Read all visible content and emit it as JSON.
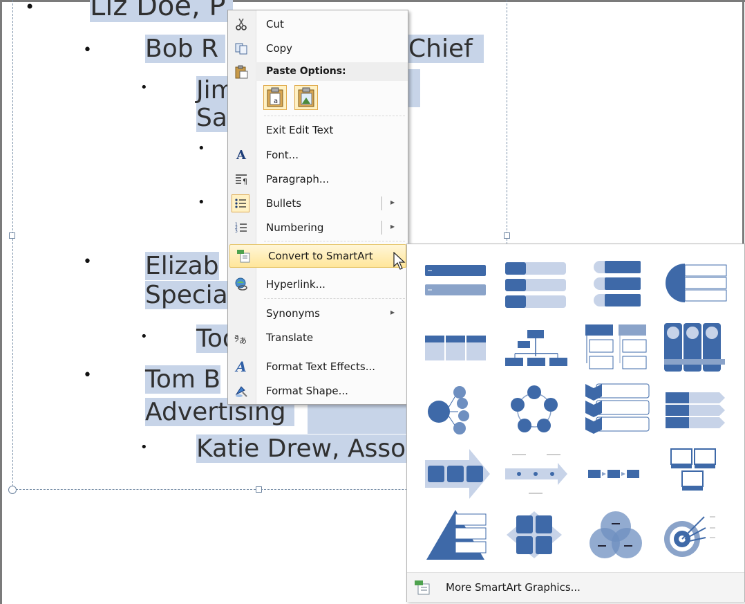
{
  "slide": {
    "lines": [
      {
        "text": "Liz Doe, President",
        "level": 1
      },
      {
        "text": "Bob Roberts, Chief",
        "level": 2
      },
      {
        "text": "Jim Sal",
        "level": 3
      },
      {
        "text": "Elizabeth Speci",
        "level": 2
      },
      {
        "text": "Tod",
        "level": 3
      },
      {
        "text": "Tom B Advertising",
        "level": 2
      },
      {
        "text": "Katie Drew, Assoc",
        "level": 3
      }
    ],
    "visible": {
      "top": "Liz Doe, P",
      "bob": "Bob R",
      "chief": "Chief",
      "jim": "Jim",
      "sal": "Sal",
      "eliz1": "Elizab",
      "eliz2": "Specia",
      "tod": "Tod",
      "tom1": "Tom B",
      "tom2": "Advertising",
      "katie": "Katie Drew, Assoc"
    }
  },
  "context_menu": {
    "cut": "Cut",
    "copy": "Copy",
    "paste_options": "Paste Options:",
    "exit_edit_text": "Exit Edit Text",
    "font": "Font...",
    "paragraph": "Paragraph...",
    "bullets": "Bullets",
    "numbering": "Numbering",
    "convert_smartart": "Convert to SmartArt",
    "hyperlink": "Hyperlink...",
    "synonyms": "Synonyms",
    "translate": "Translate",
    "format_text_effects": "Format Text Effects...",
    "format_shape": "Format Shape..."
  },
  "smartart_gallery": {
    "more": "More SmartArt Graphics...",
    "layouts": [
      "basic-block-list",
      "vertical-bullet-list",
      "vertical-box-list",
      "segmented-arc-list",
      "horizontal-bullet-list",
      "organization-chart",
      "hierarchy-list",
      "picture-columns",
      "radial-cluster",
      "basic-cycle",
      "vertical-chevron-list",
      "horizontal-arrow-list",
      "process-arrows",
      "basic-timeline",
      "basic-process",
      "picture-process",
      "pyramid-list",
      "matrix",
      "venn",
      "target"
    ]
  },
  "colors": {
    "selection": "#c7d4e8",
    "smartart_dark": "#3e69a8",
    "smartart_light": "#c7d3e8",
    "highlight": "#ffe69a"
  }
}
